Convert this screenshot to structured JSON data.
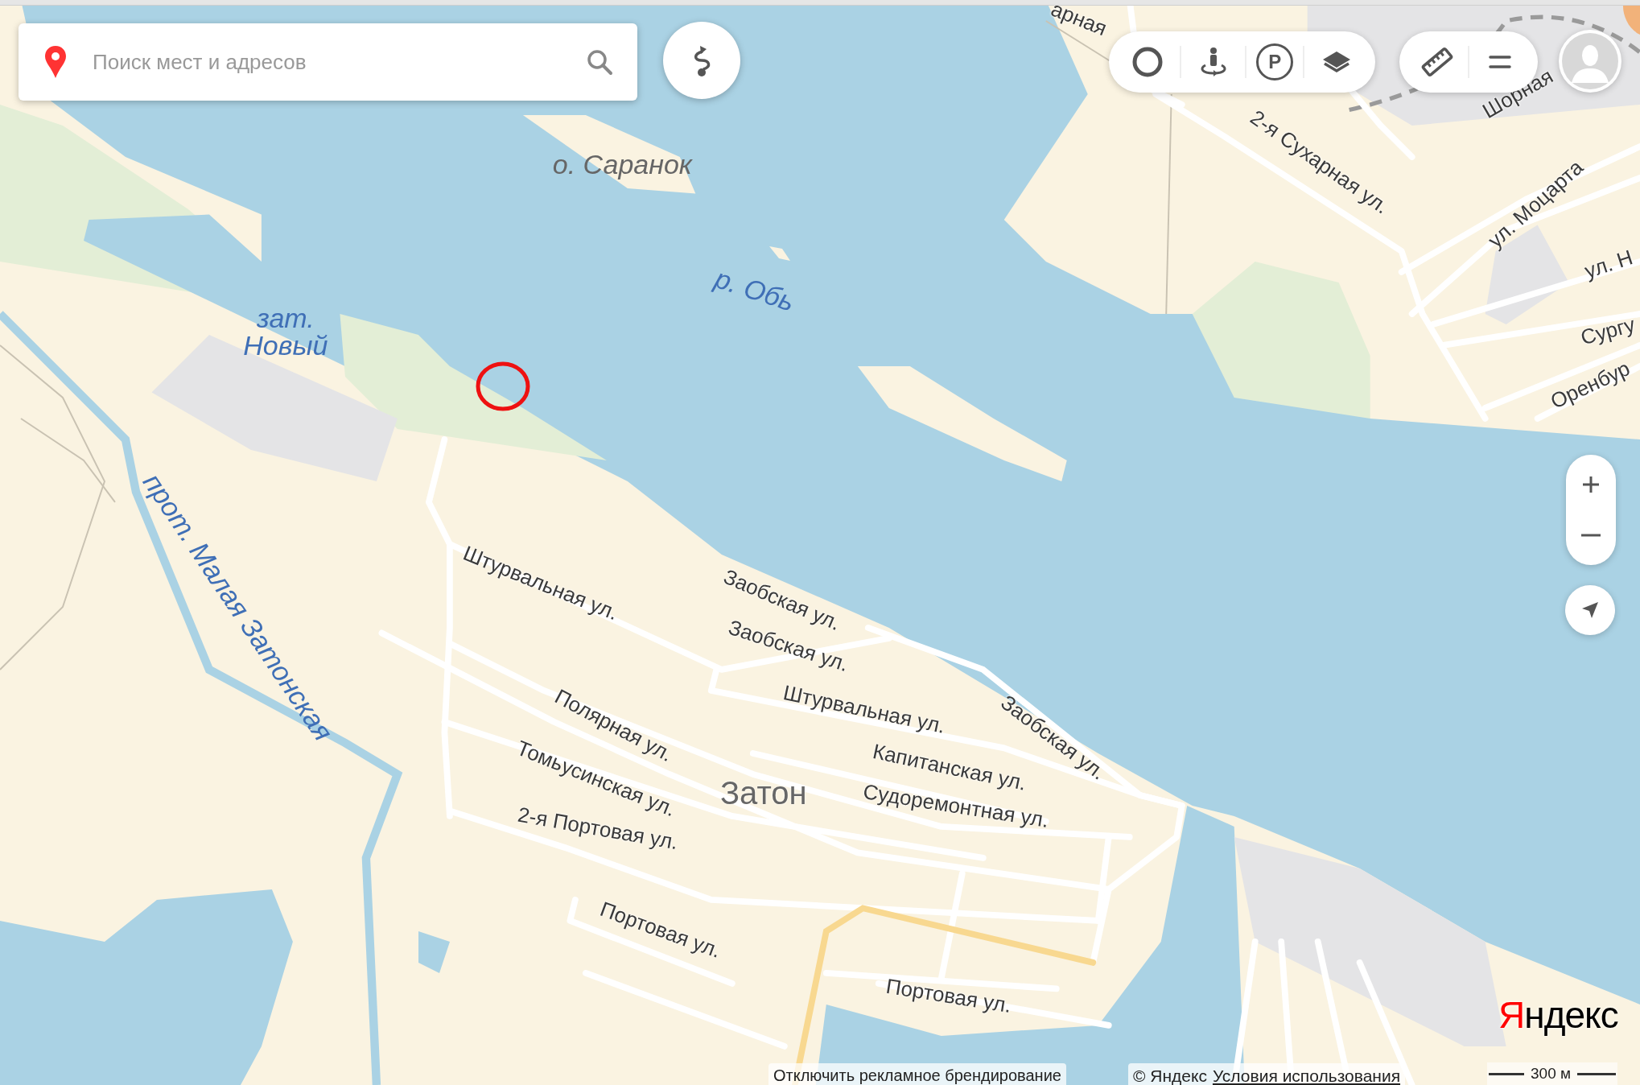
{
  "search": {
    "placeholder": "Поиск мест и адресов"
  },
  "toolbar": {
    "parking_label": "P"
  },
  "map_labels": [
    {
      "text": "арная",
      "kind": "street"
    },
    {
      "text": "о. Саранок",
      "kind": "island"
    },
    {
      "text": "р. Обь",
      "kind": "water"
    },
    {
      "text": "зат. Новый",
      "kind": "water"
    },
    {
      "text": "прот. Малая Затонская",
      "kind": "water"
    },
    {
      "text": "2-я Сухарная ул.",
      "kind": "street"
    },
    {
      "text": "Шорная",
      "kind": "street"
    },
    {
      "text": "ул. Моцарта",
      "kind": "street"
    },
    {
      "text": "ул. Н",
      "kind": "street"
    },
    {
      "text": "Сургу",
      "kind": "street"
    },
    {
      "text": "Оренбур",
      "kind": "street"
    },
    {
      "text": "Штурвальная ул.",
      "kind": "street"
    },
    {
      "text": "Заобская ул.",
      "kind": "street"
    },
    {
      "text": "Заобская ул.",
      "kind": "street"
    },
    {
      "text": "Штурвальная ул.",
      "kind": "street"
    },
    {
      "text": "Заобская ул.",
      "kind": "street"
    },
    {
      "text": "Полярная ул.",
      "kind": "street"
    },
    {
      "text": "Капитанская ул.",
      "kind": "street"
    },
    {
      "text": "Томьусинская ул.",
      "kind": "street"
    },
    {
      "text": "Затон",
      "kind": "district"
    },
    {
      "text": "Судоремонтная ул.",
      "kind": "street"
    },
    {
      "text": "2-я Портовая ул.",
      "kind": "street"
    },
    {
      "text": "Портовая ул.",
      "kind": "street"
    },
    {
      "text": "Портовая ул.",
      "kind": "street"
    }
  ],
  "footer": {
    "branding_toggle": "Отключить рекламное брендирование",
    "copyright": "© Яндекс",
    "terms_link": "Условия использования"
  },
  "logo": "Яндекс",
  "scale": "300 м"
}
